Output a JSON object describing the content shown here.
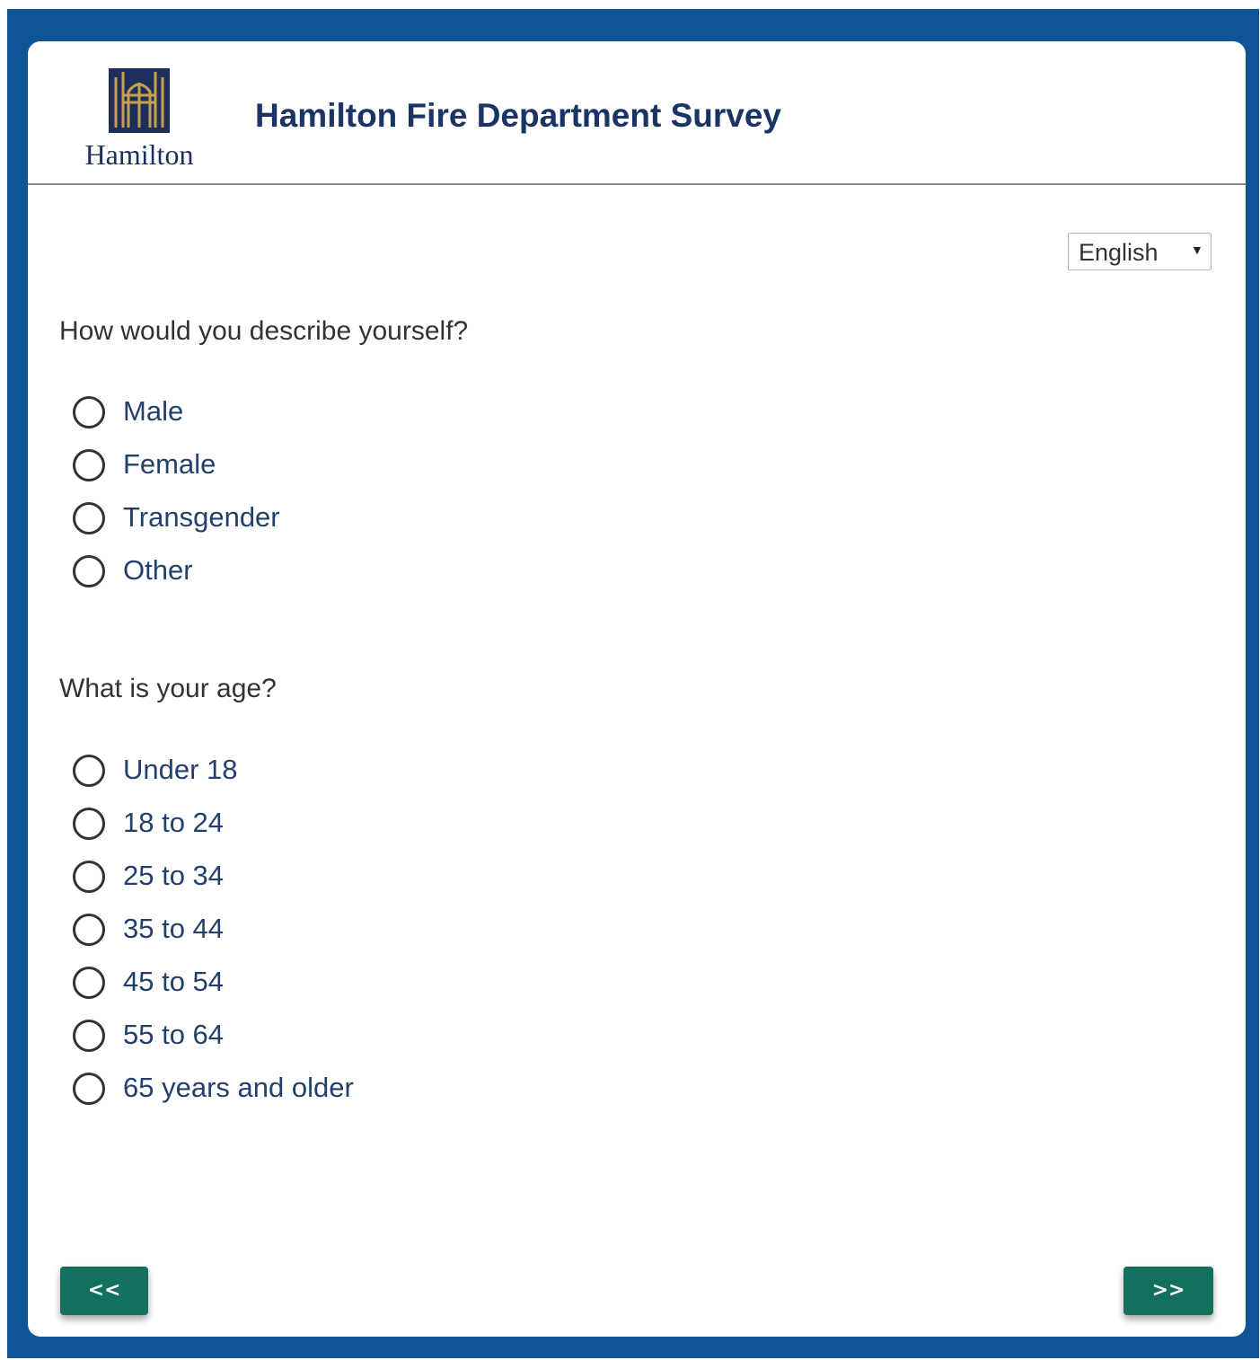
{
  "header": {
    "logo_text": "Hamilton",
    "title": "Hamilton Fire Department Survey"
  },
  "colors": {
    "frame": "#0f5494",
    "title": "#1b3466",
    "option_text": "#233f6c",
    "button": "#13705e",
    "logo_mark_bg": "#1d2f5a",
    "logo_mark_lines": "#c9a14a"
  },
  "language": {
    "selected": "English",
    "caret_icon": "chevron-down-icon"
  },
  "questions": [
    {
      "text": "How would you describe yourself?",
      "options": [
        "Male",
        "Female",
        "Transgender",
        "Other"
      ]
    },
    {
      "text": "What is your age?",
      "options": [
        "Under 18",
        "18 to 24",
        "25 to 34",
        "35 to 44",
        "45 to 54",
        "55 to 64",
        "65 years and older"
      ]
    }
  ],
  "navigation": {
    "back_label": "<<",
    "next_label": ">>"
  }
}
